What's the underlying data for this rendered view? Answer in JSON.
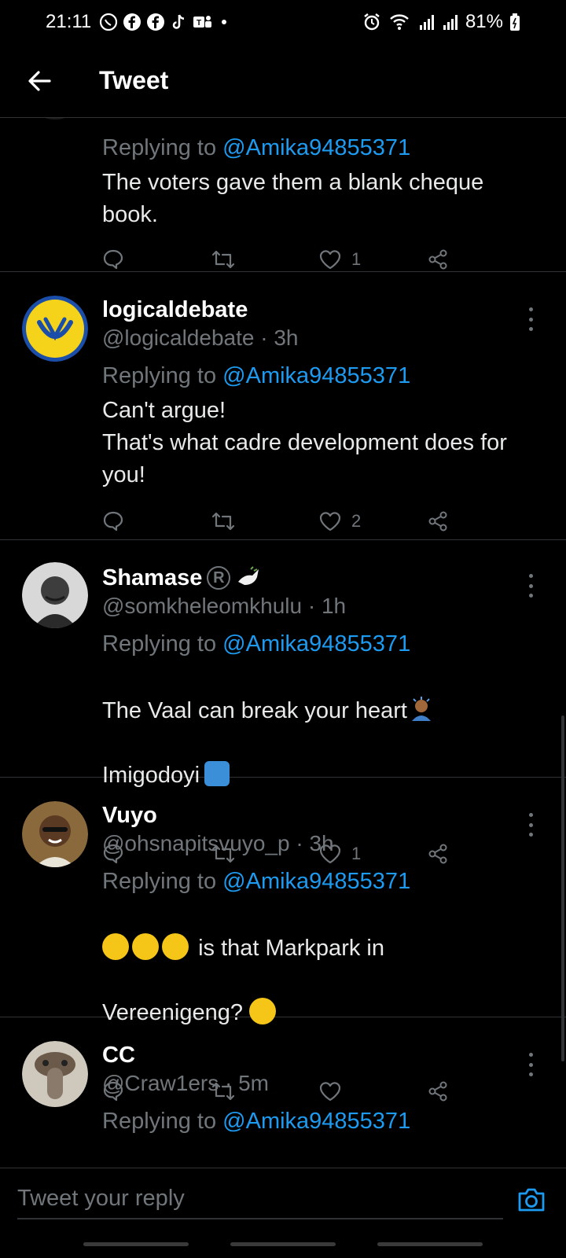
{
  "status_bar": {
    "time": "21:11",
    "battery": "81%"
  },
  "header": {
    "title": "Tweet"
  },
  "tweets": [
    {
      "replying_prefix": "Replying to",
      "replying_to": "@Amika94855371",
      "text": "The voters gave them a blank cheque book.",
      "likes": "1"
    },
    {
      "name": "logicaldebate",
      "handle_line": "@logicaldebate · 3h",
      "replying_prefix": "Replying to",
      "replying_to": "@Amika94855371",
      "text": "Can't argue!\nThat's what cadre development does for you!",
      "likes": "2"
    },
    {
      "name": "Shamase",
      "handle_line": "@somkheleomkhulu · 1h",
      "replying_prefix": "Replying to",
      "replying_to": "@Amika94855371",
      "text_line1": "The Vaal can break your heart",
      "text_line2": "Imigodoyi",
      "likes": "1"
    },
    {
      "name": "Vuyo",
      "handle_line": "@ohsnapitsvuyo_p · 3h",
      "replying_prefix": "Replying to",
      "replying_to": "@Amika94855371",
      "text_line1": "is that Markpark in",
      "text_line2": "Vereenigeng?",
      "likes": ""
    },
    {
      "name": "CC",
      "handle_line": "@Craw1ers · 5m",
      "replying_prefix": "Replying to",
      "replying_to": "@Amika94855371"
    }
  ],
  "reply_bar": {
    "placeholder": "Tweet your reply"
  },
  "colors": {
    "background": "#000000",
    "accent": "#1d9bf0",
    "secondary_text": "#71767b",
    "divider": "#2f3336"
  }
}
